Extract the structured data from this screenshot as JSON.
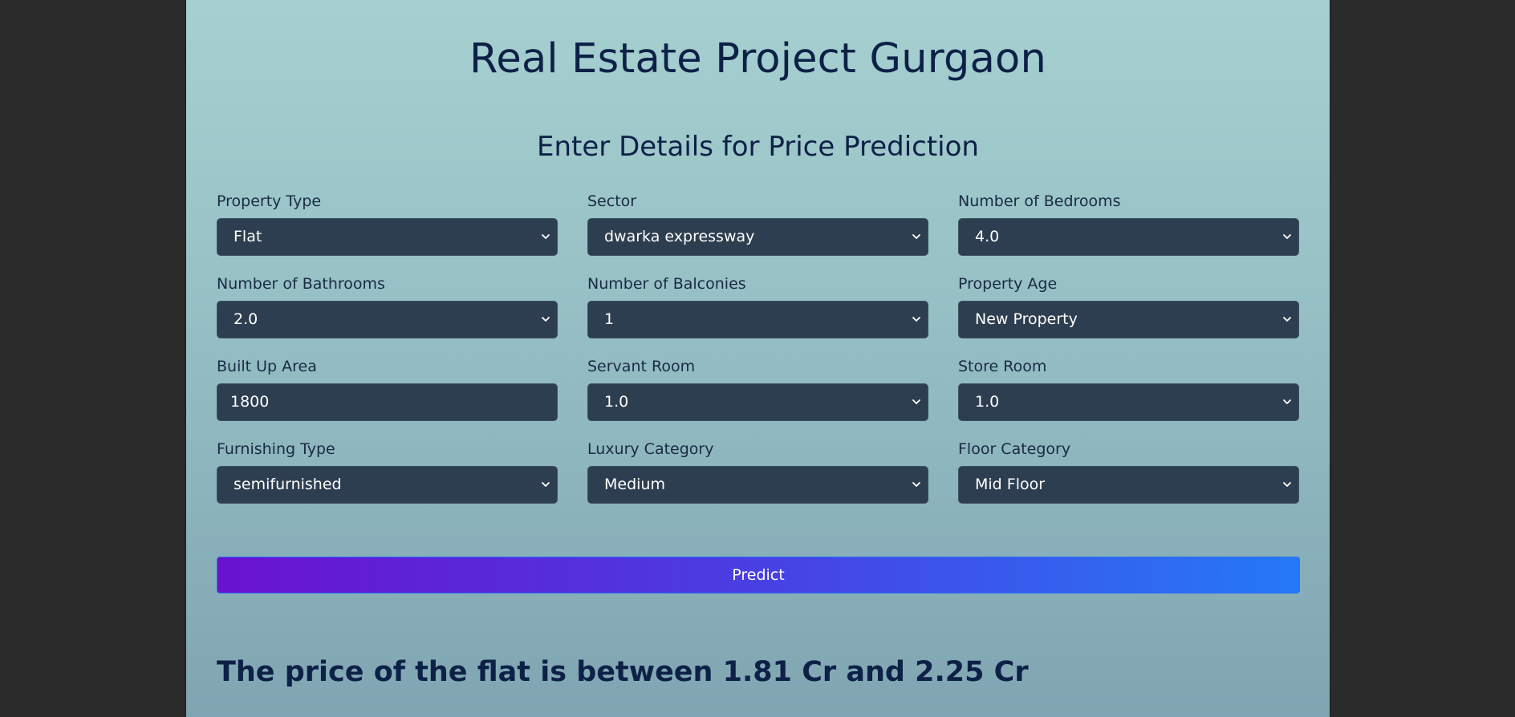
{
  "header": {
    "title": "Real Estate Project Gurgaon",
    "subtitle": "Enter Details for Price Prediction"
  },
  "form": {
    "fields": [
      {
        "label": "Property Type",
        "value": "Flat",
        "type": "select"
      },
      {
        "label": "Sector",
        "value": "dwarka expressway",
        "type": "select"
      },
      {
        "label": "Number of Bedrooms",
        "value": "4.0",
        "type": "select"
      },
      {
        "label": "Number of Bathrooms",
        "value": "2.0",
        "type": "select"
      },
      {
        "label": "Number of Balconies",
        "value": "1",
        "type": "select"
      },
      {
        "label": "Property Age",
        "value": "New Property",
        "type": "select"
      },
      {
        "label": "Built Up Area",
        "value": "1800",
        "type": "input"
      },
      {
        "label": "Servant Room",
        "value": "1.0",
        "type": "select"
      },
      {
        "label": "Store Room",
        "value": "1.0",
        "type": "select"
      },
      {
        "label": "Furnishing Type",
        "value": "semifurnished",
        "type": "select"
      },
      {
        "label": "Luxury Category",
        "value": "Medium",
        "type": "select"
      },
      {
        "label": "Floor Category",
        "value": "Mid Floor",
        "type": "select"
      }
    ],
    "predict_label": "Predict"
  },
  "result": {
    "text": "The price of the flat is between 1.81 Cr and 2.25 Cr"
  },
  "colors": {
    "heading": "#0d2147",
    "control_bg": "#2d3e50",
    "button_start": "#6a12cf",
    "button_end": "#2579f8"
  },
  "icons": {
    "select_arrow": "chevron-down-icon"
  }
}
